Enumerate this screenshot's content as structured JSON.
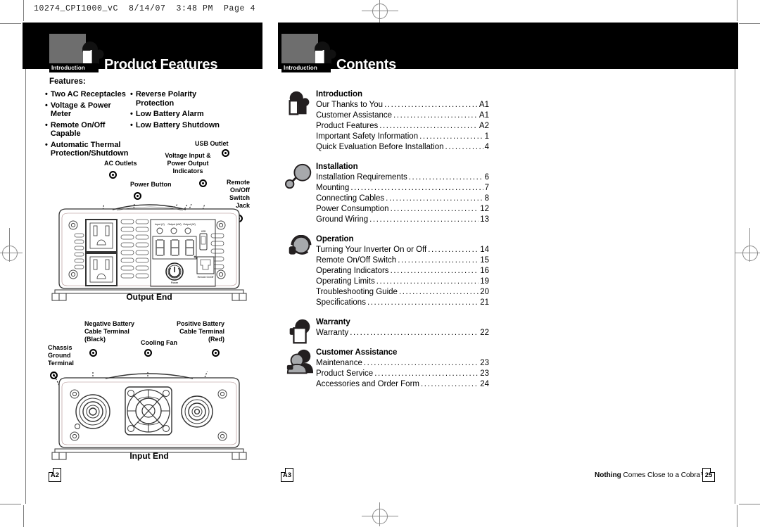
{
  "printer_slug": "10274_CPI1000_vC  8/14/07  3:48 PM  Page 4",
  "left_page": {
    "tab_label": "Introduction",
    "title": "Product Features",
    "features_heading": "Features:",
    "features_col1": [
      "Two AC Receptacles",
      "Voltage & Power Meter",
      "Remote On/Off Capable",
      "Automatic Thermal\nProtection/Shutdown"
    ],
    "features_col2": [
      "Reverse Polarity\nProtection",
      "Low Battery Alarm",
      "Low Battery Shutdown"
    ],
    "output_diagram": {
      "caption": "Output End",
      "callouts": [
        "AC Outlets",
        "Power Button",
        "Voltage Input &\nPower Output\nIndicators",
        "USB Outlet",
        "Remote\nOn/Off\nSwitch\nJack"
      ],
      "panel_micro_labels": [
        "Input (V)",
        "Output (kW)",
        "Output (W)"
      ],
      "power_button_label": "Power",
      "jack_label": "Remote On/Off",
      "usb_label": "USB"
    },
    "input_diagram": {
      "caption": "Input End",
      "callouts": [
        "Chassis\nGround\nTerminal",
        "Negative Battery\nCable Terminal\n(Black)",
        "Cooling Fan",
        "Positive Battery\nCable Terminal\n(Red)"
      ]
    },
    "page_marker": "A2"
  },
  "right_page": {
    "tab_label": "Introduction",
    "title": "Contents",
    "sections": [
      {
        "icon": "book-icon",
        "heading": "Introduction",
        "entries": [
          {
            "name": "Our Thanks to You",
            "page": "A1"
          },
          {
            "name": "Customer Assistance",
            "page": "A1"
          },
          {
            "name": "Product Features",
            "page": "A2"
          },
          {
            "name": "Important Safety Information",
            "page": "1"
          },
          {
            "name": "Quick Evaluation Before Installation",
            "page": "4"
          }
        ]
      },
      {
        "icon": "wrench-icon",
        "heading": "Installation",
        "entries": [
          {
            "name": "Installation Requirements",
            "page": "6"
          },
          {
            "name": "Mounting",
            "page": "7"
          },
          {
            "name": "Connecting Cables",
            "page": "8"
          },
          {
            "name": "Power Consumption",
            "page": "12"
          },
          {
            "name": "Ground Wiring",
            "page": "13"
          }
        ]
      },
      {
        "icon": "headset-icon",
        "heading": "Operation",
        "entries": [
          {
            "name": "Turning Your Inverter On or Off",
            "page": "14"
          },
          {
            "name": "Remote On/Off Switch",
            "page": "15"
          },
          {
            "name": "Operating Indicators",
            "page": "16"
          },
          {
            "name": "Operating Limits",
            "page": "19"
          },
          {
            "name": "Troubleshooting Guide",
            "page": "20"
          },
          {
            "name": "Specifications",
            "page": "21"
          }
        ]
      },
      {
        "icon": "certificate-icon",
        "heading": "Warranty",
        "entries": [
          {
            "name": "Warranty",
            "page": "22"
          }
        ]
      },
      {
        "icon": "support-person-icon",
        "heading": "Customer Assistance",
        "entries": [
          {
            "name": "Maintenance",
            "page": "23"
          },
          {
            "name": "Product Service",
            "page": "23"
          },
          {
            "name": "Accessories and Order Form",
            "page": "24"
          }
        ]
      }
    ],
    "page_marker": "A3",
    "tagline_bold": "Nothing",
    "tagline_rest": " Comes Close to a Cobra™",
    "folio": "25"
  },
  "colors": {
    "band": "#000000",
    "tab_gray": "#6e6e6e",
    "text": "#000000",
    "mark_gray": "#8a8a8a"
  }
}
